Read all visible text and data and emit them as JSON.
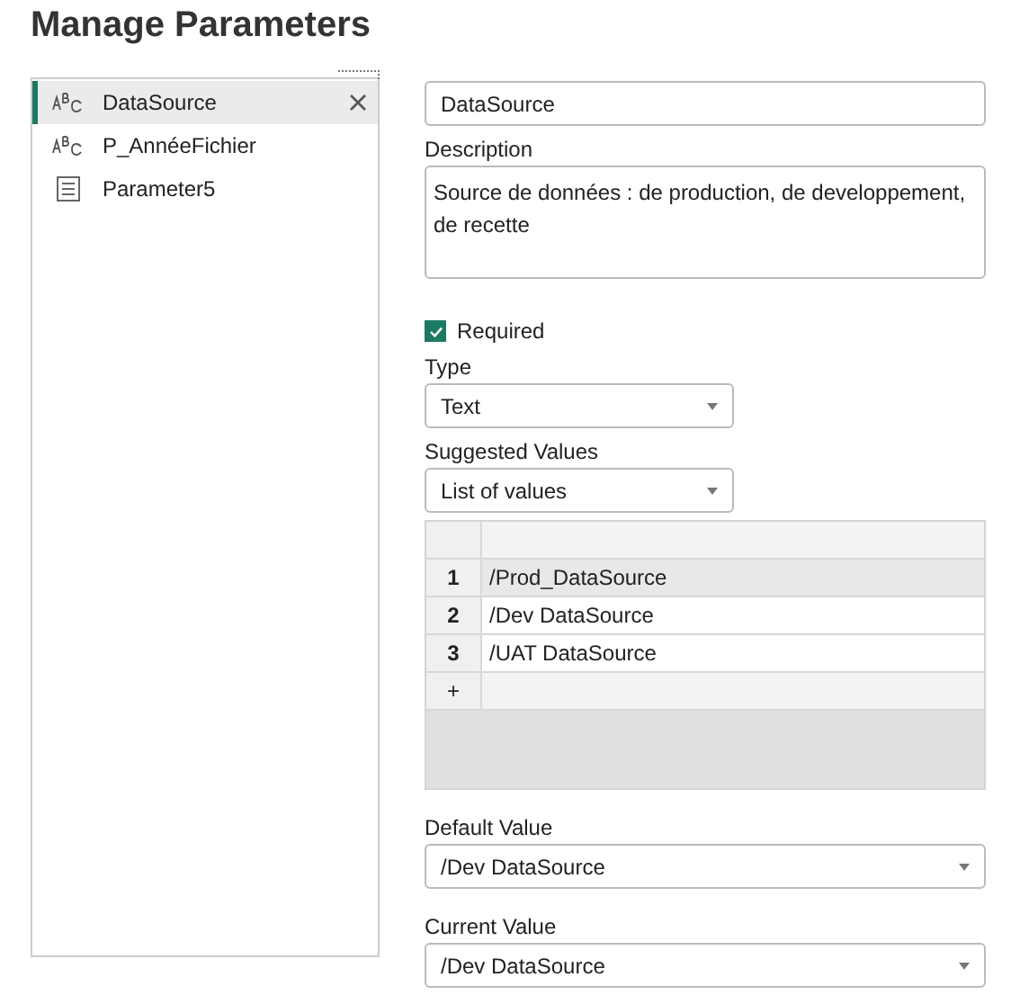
{
  "title": "Manage Parameters",
  "parameters": [
    {
      "name": "DataSource",
      "kind": "text",
      "selected": true
    },
    {
      "name": "P_AnnéeFichier",
      "kind": "text",
      "selected": false
    },
    {
      "name": "Parameter5",
      "kind": "list",
      "selected": false
    }
  ],
  "name_value": "DataSource",
  "description": {
    "label": "Description",
    "value": "Source de données : de production, de developpement, de recette"
  },
  "required": {
    "label": "Required",
    "checked": true
  },
  "type": {
    "label": "Type",
    "value": "Text"
  },
  "suggested_values": {
    "label": "Suggested Values",
    "value": "List of values"
  },
  "values_table": {
    "rows": [
      {
        "index": "1",
        "value": "/Prod_DataSource",
        "selected": true
      },
      {
        "index": "2",
        "value": "/Dev DataSource",
        "selected": false
      },
      {
        "index": "3",
        "value": "/UAT DataSource",
        "selected": false
      }
    ],
    "add_row": "+"
  },
  "default_value": {
    "label": "Default Value",
    "value": "/Dev DataSource"
  },
  "current_value": {
    "label": "Current Value",
    "value": "/Dev DataSource"
  }
}
